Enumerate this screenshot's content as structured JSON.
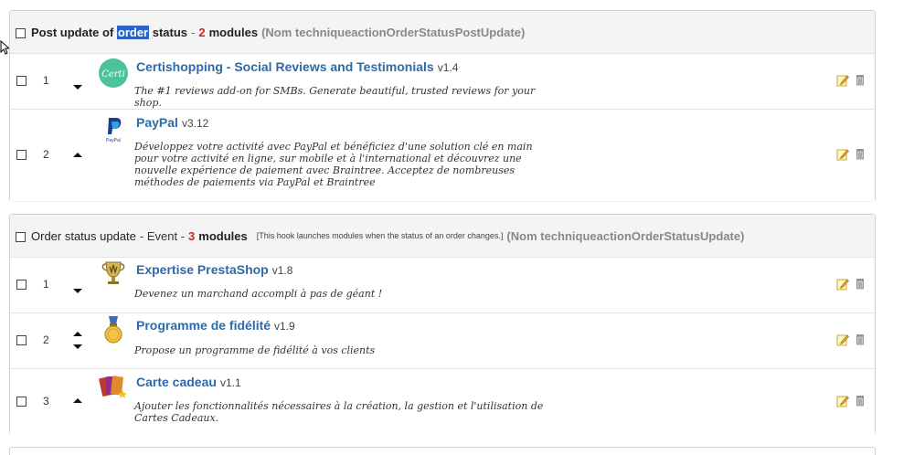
{
  "hooks": [
    {
      "title_before": "Post update of ",
      "title_highlight": "order",
      "title_after": " status",
      "dash": "-",
      "count": "2",
      "modules_label": "modules",
      "note": "",
      "technical_name": "(Nom techniqueactionOrderStatusPostUpdate)",
      "modules": [
        {
          "position": "1",
          "name": "Certishopping - Social Reviews and Testimonials",
          "version": "v1.4",
          "description": "The #1 reviews add-on for SMBs. Generate beautiful, trusted reviews for your shop.",
          "logo_icon": "certi-logo-icon",
          "logo_text": "Certi",
          "arrows": [
            "down"
          ]
        },
        {
          "position": "2",
          "name": "PayPal",
          "version": "v3.12",
          "description": "Développez votre activité avec PayPal et bénéficiez d'une solution clé en main pour votre activité en ligne, sur mobile et à l'international et découvrez une nouvelle expérience de paiement avec Braintree. Acceptez de nombreuses méthodes de paiements via PayPal et Braintree",
          "logo_icon": "paypal-logo-icon",
          "logo_text": "PayPal",
          "arrows": [
            "up"
          ]
        }
      ]
    },
    {
      "title_before": "Order status update",
      "title_highlight": "",
      "title_after": "",
      "dash": "- Event -",
      "count": "3",
      "modules_label": "modules",
      "note": "[This hook launches modules when the status of an order changes.]",
      "technical_name": "(Nom techniqueactionOrderStatusUpdate)",
      "modules": [
        {
          "position": "1",
          "name": "Expertise PrestaShop",
          "version": "v1.8",
          "description": "Devenez un marchand accompli à pas de géant !",
          "logo_icon": "trophy-icon",
          "arrows": [
            "down"
          ]
        },
        {
          "position": "2",
          "name": "Programme de fidélité",
          "version": "v1.9",
          "description": "Propose un programme de fidélité à vos clients",
          "logo_icon": "medal-icon",
          "arrows": [
            "up",
            "down"
          ]
        },
        {
          "position": "3",
          "name": "Carte cadeau",
          "version": "v1.1",
          "description": "Ajouter les fonctionnalités nécessaires à la création, la gestion et l'utilisation de Cartes Cadeaux.",
          "logo_icon": "gift-card-icon",
          "arrows": [
            "up"
          ]
        }
      ]
    }
  ],
  "icons": {
    "edit": "pencil-edit-icon",
    "delete": "trash-icon"
  },
  "colors": {
    "link": "#2e6aa8",
    "count": "#d0261b",
    "highlight": "#2a64c6",
    "certi_green": "#4cc39a"
  }
}
